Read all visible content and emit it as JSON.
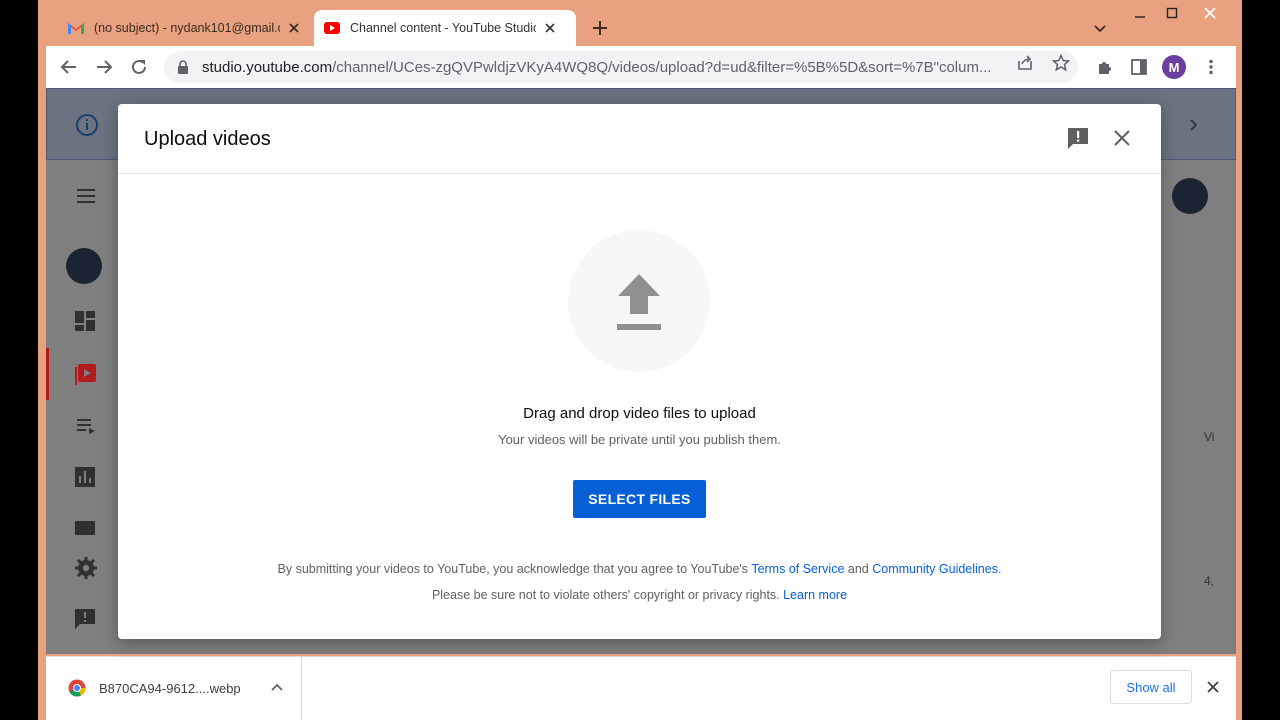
{
  "browser": {
    "tabs": [
      {
        "label": "(no subject) - nydank101@gmail.com",
        "favicon": "gmail-icon",
        "active": false
      },
      {
        "label": "Channel content - YouTube Studio",
        "favicon": "youtube-icon",
        "active": true
      }
    ],
    "url_host": "studio.youtube.com",
    "url_path": "/channel/UCes-zgQVPwldjzVKyA4WQ8Q/videos/upload?d=ud&filter=%5B%5D&sort=%7B\"colum...",
    "profile_initial": "M"
  },
  "background": {
    "right_text_1": "Vi",
    "right_text_2": "4,"
  },
  "modal": {
    "title": "Upload videos",
    "drag_text": "Drag and drop video files to upload",
    "private_text": "Your videos will be private until you publish them.",
    "select_button": "SELECT FILES",
    "legal_prefix": "By submitting your videos to YouTube, you acknowledge that you agree to YouTube's ",
    "terms_link": "Terms of Service",
    "legal_and": " and ",
    "guidelines_link": "Community Guidelines",
    "legal_end": ".",
    "legal2_prefix": "Please be sure not to violate others' copyright or privacy rights. ",
    "learn_more": "Learn more"
  },
  "shelf": {
    "file_name": "B870CA94-9612....webp",
    "show_all": "Show all"
  },
  "colors": {
    "accent": "#065fd4",
    "window_frame": "#e9a27f",
    "youtube_red": "#ff0000"
  }
}
